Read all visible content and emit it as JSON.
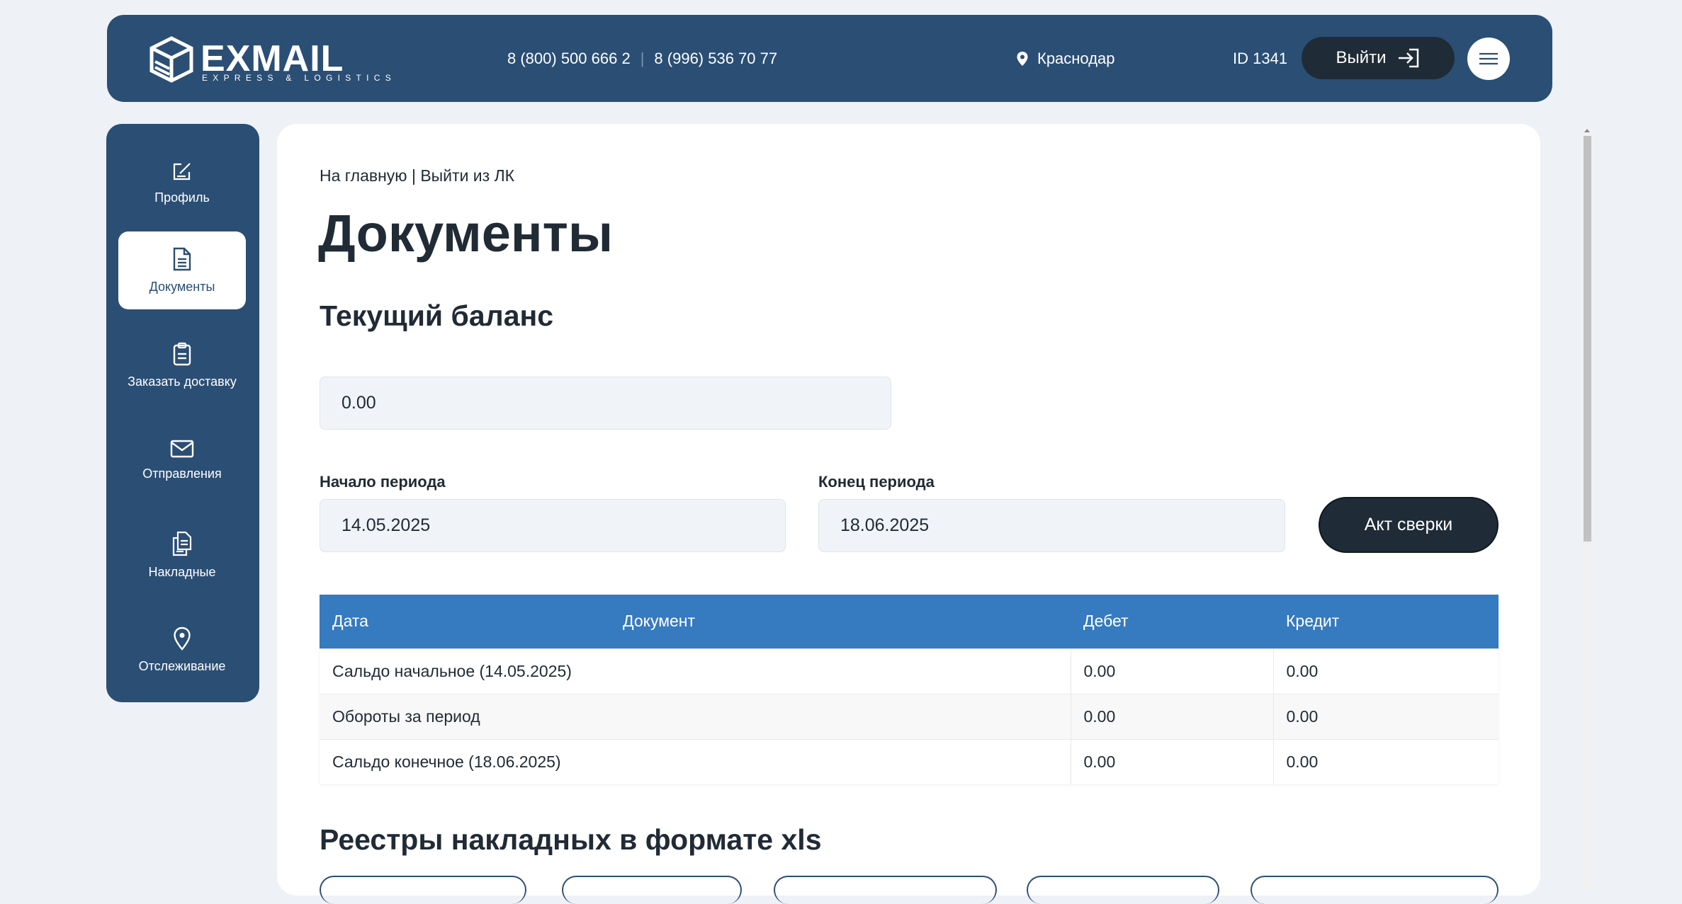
{
  "header": {
    "logo_text": "EXMAIL",
    "logo_sub": "EXPRESS & LOGISTICS",
    "phone_1": "8 (800) 500 666 2",
    "phone_2": "8 (996) 536 70 77",
    "city": "Краснодар",
    "user_id": "ID 1341",
    "logout_label": "Выйти"
  },
  "sidebar": {
    "items": [
      {
        "label": "Профиль",
        "icon": "edit-icon"
      },
      {
        "label": "Документы",
        "icon": "document-icon",
        "active": true
      },
      {
        "label": "Заказать доставку",
        "icon": "clipboard-icon"
      },
      {
        "label": "Отправления",
        "icon": "envelope-icon"
      },
      {
        "label": "Накладные",
        "icon": "documents-icon"
      },
      {
        "label": "Отслеживание",
        "icon": "location-pin-icon"
      }
    ]
  },
  "main": {
    "breadcrumb": "На главную | Выйти из ЛК",
    "title": "Документы",
    "balance_title": "Текущий баланс",
    "balance_value": "0.00",
    "period_start_label": "Начало периода",
    "period_start_value": "14.05.2025",
    "period_end_label": "Конец периода",
    "period_end_value": "18.06.2025",
    "act_button_label": "Акт сверки",
    "table": {
      "headers": [
        "Дата",
        "Документ",
        "Дебет",
        "Кредит"
      ],
      "rows": [
        {
          "name": "Сальдо начальное (14.05.2025)",
          "debit": "0.00",
          "credit": "0.00"
        },
        {
          "name": "Обороты за период",
          "debit": "0.00",
          "credit": "0.00"
        },
        {
          "name": "Сальдо конечное (18.06.2025)",
          "debit": "0.00",
          "credit": "0.00"
        }
      ]
    },
    "registry_title": "Реестры накладных в формате xls"
  },
  "colors": {
    "header_bg": "#2b4e74",
    "table_header_bg": "#367ac0",
    "dark_button": "#1f2b36",
    "page_bg": "#eef2f7"
  }
}
